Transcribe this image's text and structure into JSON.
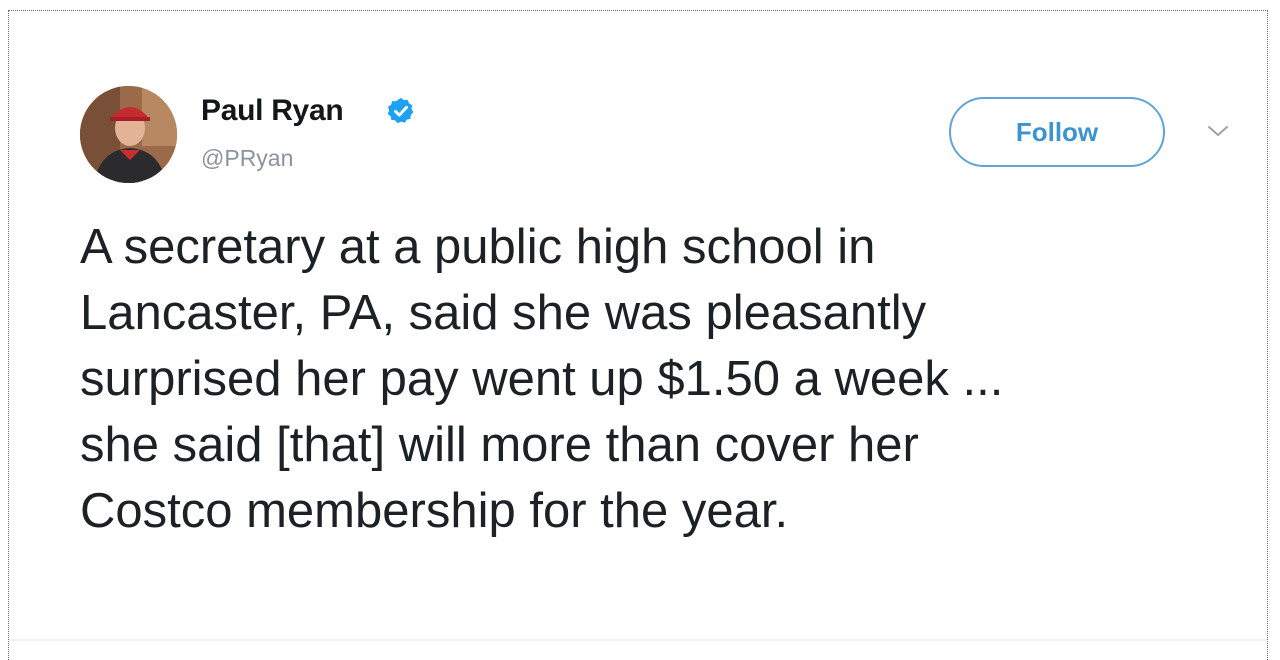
{
  "author": {
    "name": "Paul Ryan",
    "handle": "@PRyan",
    "verified": true
  },
  "actions": {
    "follow_label": "Follow",
    "more_icon": "chevron-down-icon"
  },
  "tweet": {
    "lines": [
      "A secretary at a public high school in",
      "Lancaster, PA, said she was pleasantly",
      "surprised her pay went up $1.50 a week ...",
      "she said [that] will more than cover her",
      "Costco membership for the year."
    ]
  },
  "colors": {
    "follow_border": "#5fa5d6",
    "follow_text": "#3b93d0",
    "verified_badge": "#1da1f2",
    "handle_text": "#8b949c",
    "body_text": "#1c2126"
  }
}
